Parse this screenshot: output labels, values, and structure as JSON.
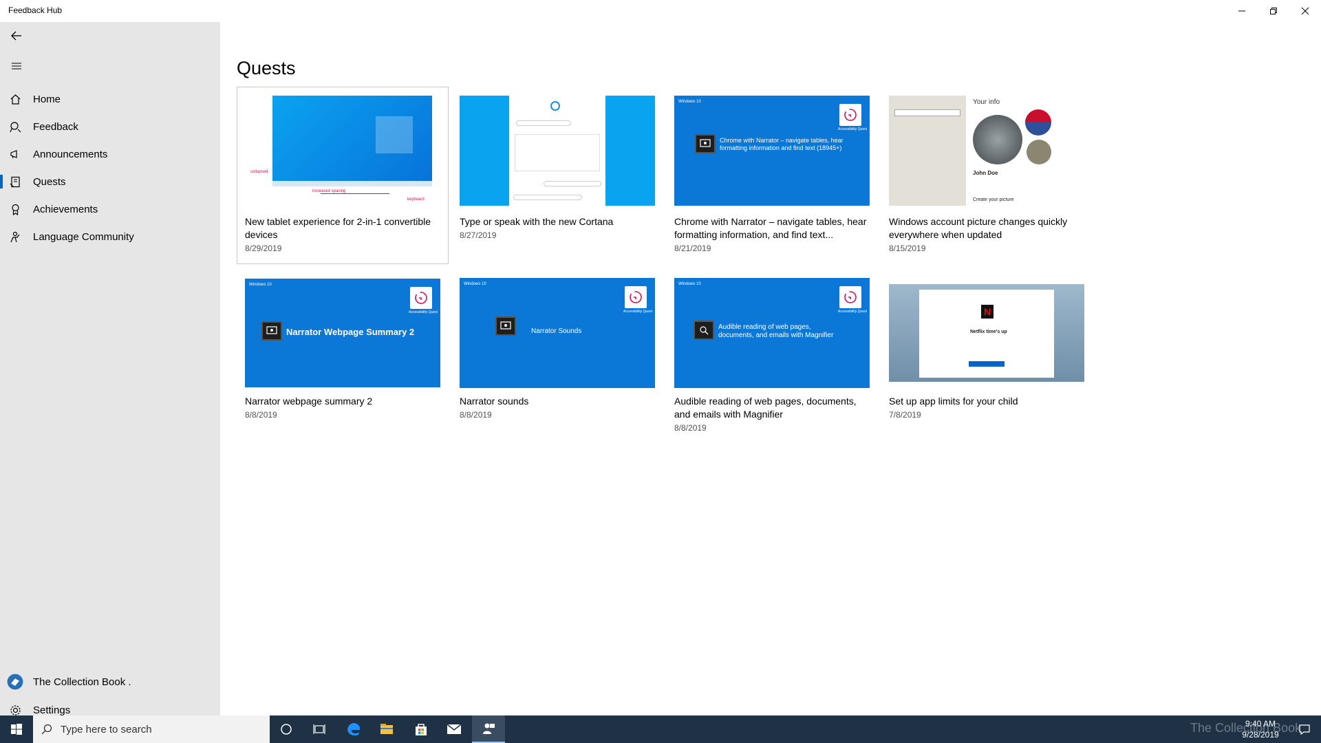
{
  "window": {
    "title": "Feedback Hub"
  },
  "sidebar": {
    "items": [
      {
        "label": "Home",
        "icon": "home-icon"
      },
      {
        "label": "Feedback",
        "icon": "feedback-icon"
      },
      {
        "label": "Announcements",
        "icon": "megaphone-icon"
      },
      {
        "label": "Quests",
        "icon": "quests-icon",
        "active": true
      },
      {
        "label": "Achievements",
        "icon": "medal-icon"
      },
      {
        "label": "Language Community",
        "icon": "language-community-icon"
      }
    ],
    "bottom": [
      {
        "label": "The Collection Book .",
        "icon": "collection-book-avatar"
      },
      {
        "label": "Settings",
        "icon": "gear-icon"
      }
    ]
  },
  "main": {
    "title": "Quests",
    "quests": [
      {
        "title": "New tablet experience for 2-in-1 convertible devices",
        "date": "8/29/2019",
        "thumb": {
          "annotations": [
            "collapsed",
            "increased spacing",
            "keyboard"
          ]
        }
      },
      {
        "title": "Type or speak with the new Cortana",
        "date": "8/27/2019"
      },
      {
        "title": "Chrome with Narrator – navigate tables, hear formatting information, and find text...",
        "date": "8/21/2019",
        "thumb": {
          "tag": "Windows 10",
          "badge": "Accessibility Quest",
          "text": "Chrome with Narrator – navigate tables, hear formatting information and find text (18945+)"
        }
      },
      {
        "title": "Windows account picture changes quickly everywhere when updated",
        "date": "8/15/2019",
        "thumb": {
          "heading": "Your info",
          "name": "John Doe",
          "footer": "Create your picture"
        }
      },
      {
        "title": "Narrator webpage summary 2",
        "date": "8/8/2019",
        "thumb": {
          "tag": "Windows 10",
          "badge": "Accessibility Quest",
          "text": "Narrator Webpage Summary 2"
        }
      },
      {
        "title": "Narrator sounds",
        "date": "8/8/2019",
        "thumb": {
          "tag": "Windows 10",
          "badge": "Accessibility Quest",
          "text": "Narrator Sounds"
        }
      },
      {
        "title": "Audible reading of web pages, documents, and emails with Magnifier",
        "date": "8/8/2019",
        "thumb": {
          "tag": "Windows 10",
          "badge": "Accessibility Quest",
          "text": "Audible reading of web pages, documents, and emails with Magnifier"
        }
      },
      {
        "title": "Set up app limits for your child",
        "date": "7/8/2019",
        "thumb": {
          "heading": "Netflix time's up",
          "brand": "N"
        }
      }
    ]
  },
  "taskbar": {
    "search_placeholder": "Type here to search",
    "time": "9:40 AM",
    "date": "9/28/2019",
    "watermark": "The Collection Book"
  },
  "colors": {
    "accent": "#0a63c9",
    "tile_blue": "#0b78d7",
    "sidebar_bg": "#e6e6e6",
    "taskbar_bg": "#1f3245"
  }
}
